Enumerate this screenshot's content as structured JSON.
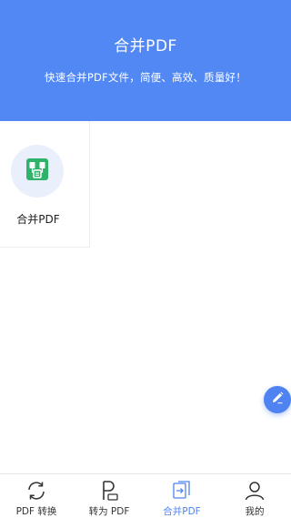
{
  "header": {
    "title": "合并PDF",
    "subtitle": "快速合并PDF文件，简便、高效、质量好！",
    "background_color": "#5288f4"
  },
  "tools": [
    {
      "label": "合并PDF",
      "icon": "merge-pdf-icon",
      "icon_color": "#2fb36b"
    }
  ],
  "fab": {
    "icon": "pencil-edit-icon",
    "color": "#4f83f2"
  },
  "tabbar": {
    "active_index": 2,
    "accent_color": "#4f83f2",
    "items": [
      {
        "label": "PDF 转换",
        "icon": "refresh-arrows-icon"
      },
      {
        "label": "转为 PDF",
        "icon": "pdf-letter-icon"
      },
      {
        "label": "合并PDF",
        "icon": "merge-docs-icon"
      },
      {
        "label": "我的",
        "icon": "user-icon"
      }
    ]
  }
}
